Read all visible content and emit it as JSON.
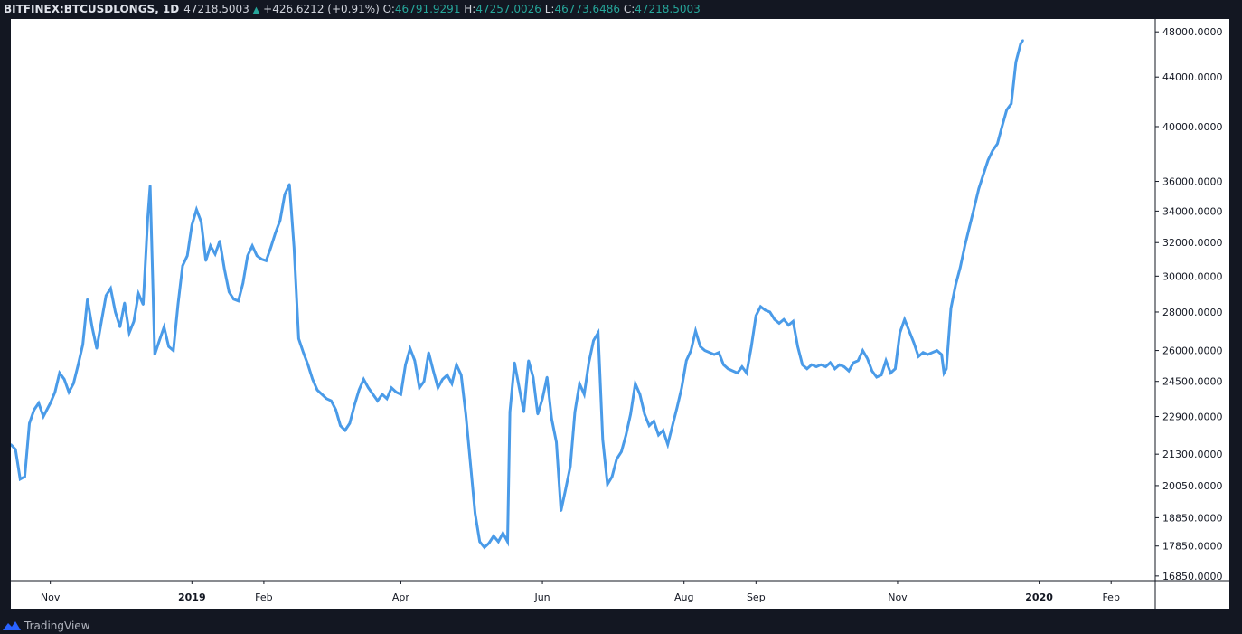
{
  "header": {
    "symbol": "BITFINEX:BTCUSDLONGS, 1D",
    "last": "47218.5003",
    "change_arrow": "▲",
    "change": "+426.6212 (+0.91%)",
    "open_label": "O:",
    "open": "46791.9291",
    "high_label": "H:",
    "high": "47257.0026",
    "low_label": "L:",
    "low": "46773.6486",
    "close_label": "C:",
    "close": "47218.5003"
  },
  "footer": {
    "brand": "TradingView"
  },
  "colors": {
    "line": "#4a9be8",
    "background": "#ffffff",
    "frame": "#131722",
    "axis_text": "#131722",
    "up": "#26a69a"
  },
  "chart_data": {
    "type": "line",
    "x_axis": {
      "type": "date",
      "range": [
        "2018-10-15",
        "2020-02-20"
      ],
      "ticks": [
        {
          "date": "2018-11-01",
          "label": "Nov",
          "bold": false
        },
        {
          "date": "2019-01-01",
          "label": "2019",
          "bold": true
        },
        {
          "date": "2019-02-01",
          "label": "Feb",
          "bold": false
        },
        {
          "date": "2019-04-01",
          "label": "Apr",
          "bold": false
        },
        {
          "date": "2019-06-01",
          "label": "Jun",
          "bold": false
        },
        {
          "date": "2019-08-01",
          "label": "Aug",
          "bold": false
        },
        {
          "date": "2019-09-01",
          "label": "Sep",
          "bold": false
        },
        {
          "date": "2019-11-01",
          "label": "Nov",
          "bold": false
        },
        {
          "date": "2020-01-01",
          "label": "2020",
          "bold": true
        },
        {
          "date": "2020-02-01",
          "label": "Feb",
          "bold": false
        }
      ]
    },
    "y_axis": {
      "scale": "log",
      "range": [
        16700,
        49200
      ],
      "ticks": [
        {
          "value": 48000,
          "label": "48000.0000"
        },
        {
          "value": 44000,
          "label": "44000.0000"
        },
        {
          "value": 40000,
          "label": "40000.0000"
        },
        {
          "value": 36000,
          "label": "36000.0000"
        },
        {
          "value": 34000,
          "label": "34000.0000"
        },
        {
          "value": 32000,
          "label": "32000.0000"
        },
        {
          "value": 30000,
          "label": "30000.0000"
        },
        {
          "value": 28000,
          "label": "28000.0000"
        },
        {
          "value": 26000,
          "label": "26000.0000"
        },
        {
          "value": 24500,
          "label": "24500.0000"
        },
        {
          "value": 22900,
          "label": "22900.0000"
        },
        {
          "value": 21300,
          "label": "21300.0000"
        },
        {
          "value": 20050,
          "label": "20050.0000"
        },
        {
          "value": 18850,
          "label": "18850.0000"
        },
        {
          "value": 17850,
          "label": "17850.0000"
        },
        {
          "value": 16850,
          "label": "16850.0000"
        }
      ]
    },
    "grid": false,
    "series": [
      {
        "values": [
          [
            "2018-10-15",
            21700
          ],
          [
            "2018-10-17",
            21500
          ],
          [
            "2018-10-19",
            20300
          ],
          [
            "2018-10-21",
            20400
          ],
          [
            "2018-10-23",
            22600
          ],
          [
            "2018-10-25",
            23200
          ],
          [
            "2018-10-27",
            23500
          ],
          [
            "2018-10-29",
            22900
          ],
          [
            "2018-11-01",
            23500
          ],
          [
            "2018-11-03",
            24000
          ],
          [
            "2018-11-05",
            24900
          ],
          [
            "2018-11-07",
            24600
          ],
          [
            "2018-11-09",
            24000
          ],
          [
            "2018-11-11",
            24400
          ],
          [
            "2018-11-13",
            25300
          ],
          [
            "2018-11-15",
            26300
          ],
          [
            "2018-11-17",
            28700
          ],
          [
            "2018-11-19",
            27200
          ],
          [
            "2018-11-21",
            26100
          ],
          [
            "2018-11-23",
            27500
          ],
          [
            "2018-11-25",
            28900
          ],
          [
            "2018-11-27",
            29300
          ],
          [
            "2018-11-29",
            28000
          ],
          [
            "2018-12-01",
            27200
          ],
          [
            "2018-12-03",
            28500
          ],
          [
            "2018-12-05",
            26900
          ],
          [
            "2018-12-07",
            27500
          ],
          [
            "2018-12-09",
            29000
          ],
          [
            "2018-12-11",
            28400
          ],
          [
            "2018-12-13",
            33600
          ],
          [
            "2018-12-14",
            35700
          ],
          [
            "2018-12-16",
            25800
          ],
          [
            "2018-12-18",
            26500
          ],
          [
            "2018-12-20",
            27200
          ],
          [
            "2018-12-22",
            26200
          ],
          [
            "2018-12-24",
            26000
          ],
          [
            "2018-12-26",
            28400
          ],
          [
            "2018-12-28",
            30600
          ],
          [
            "2018-12-30",
            31200
          ],
          [
            "2019-01-01",
            33100
          ],
          [
            "2019-01-03",
            34100
          ],
          [
            "2019-01-05",
            33300
          ],
          [
            "2019-01-07",
            30900
          ],
          [
            "2019-01-09",
            31800
          ],
          [
            "2019-01-11",
            31300
          ],
          [
            "2019-01-13",
            32100
          ],
          [
            "2019-01-15",
            30400
          ],
          [
            "2019-01-17",
            29100
          ],
          [
            "2019-01-19",
            28700
          ],
          [
            "2019-01-21",
            28600
          ],
          [
            "2019-01-23",
            29600
          ],
          [
            "2019-01-25",
            31200
          ],
          [
            "2019-01-27",
            31800
          ],
          [
            "2019-01-29",
            31200
          ],
          [
            "2019-01-31",
            31000
          ],
          [
            "2019-02-02",
            30900
          ],
          [
            "2019-02-04",
            31700
          ],
          [
            "2019-02-06",
            32600
          ],
          [
            "2019-02-08",
            33400
          ],
          [
            "2019-02-10",
            35100
          ],
          [
            "2019-02-12",
            35800
          ],
          [
            "2019-02-14",
            31700
          ],
          [
            "2019-02-16",
            26600
          ],
          [
            "2019-02-18",
            25900
          ],
          [
            "2019-02-20",
            25300
          ],
          [
            "2019-02-22",
            24600
          ],
          [
            "2019-02-24",
            24100
          ],
          [
            "2019-02-26",
            23900
          ],
          [
            "2019-02-28",
            23700
          ],
          [
            "2019-03-02",
            23600
          ],
          [
            "2019-03-04",
            23200
          ],
          [
            "2019-03-06",
            22500
          ],
          [
            "2019-03-08",
            22300
          ],
          [
            "2019-03-10",
            22600
          ],
          [
            "2019-03-12",
            23400
          ],
          [
            "2019-03-14",
            24100
          ],
          [
            "2019-03-16",
            24600
          ],
          [
            "2019-03-18",
            24200
          ],
          [
            "2019-03-20",
            23900
          ],
          [
            "2019-03-22",
            23600
          ],
          [
            "2019-03-24",
            23900
          ],
          [
            "2019-03-26",
            23700
          ],
          [
            "2019-03-28",
            24200
          ],
          [
            "2019-03-30",
            24000
          ],
          [
            "2019-04-01",
            23900
          ],
          [
            "2019-04-03",
            25300
          ],
          [
            "2019-04-05",
            26100
          ],
          [
            "2019-04-07",
            25500
          ],
          [
            "2019-04-09",
            24200
          ],
          [
            "2019-04-11",
            24500
          ],
          [
            "2019-04-13",
            25900
          ],
          [
            "2019-04-15",
            25000
          ],
          [
            "2019-04-17",
            24200
          ],
          [
            "2019-04-19",
            24600
          ],
          [
            "2019-04-21",
            24800
          ],
          [
            "2019-04-23",
            24400
          ],
          [
            "2019-04-25",
            25300
          ],
          [
            "2019-04-27",
            24800
          ],
          [
            "2019-04-29",
            23000
          ],
          [
            "2019-05-01",
            20900
          ],
          [
            "2019-05-03",
            19000
          ],
          [
            "2019-05-05",
            18000
          ],
          [
            "2019-05-07",
            17800
          ],
          [
            "2019-05-09",
            17950
          ],
          [
            "2019-05-11",
            18200
          ],
          [
            "2019-05-13",
            18000
          ],
          [
            "2019-05-15",
            18300
          ],
          [
            "2019-05-17",
            18000
          ],
          [
            "2019-05-18",
            23100
          ],
          [
            "2019-05-20",
            25400
          ],
          [
            "2019-05-22",
            24200
          ],
          [
            "2019-05-24",
            23100
          ],
          [
            "2019-05-26",
            25500
          ],
          [
            "2019-05-28",
            24700
          ],
          [
            "2019-05-30",
            23000
          ],
          [
            "2019-06-01",
            23700
          ],
          [
            "2019-06-03",
            24700
          ],
          [
            "2019-06-05",
            22800
          ],
          [
            "2019-06-07",
            21800
          ],
          [
            "2019-06-09",
            19100
          ],
          [
            "2019-06-11",
            19900
          ],
          [
            "2019-06-13",
            20800
          ],
          [
            "2019-06-15",
            23100
          ],
          [
            "2019-06-17",
            24400
          ],
          [
            "2019-06-19",
            23900
          ],
          [
            "2019-06-21",
            25400
          ],
          [
            "2019-06-23",
            26500
          ],
          [
            "2019-06-25",
            26900
          ],
          [
            "2019-06-27",
            21900
          ],
          [
            "2019-06-29",
            20100
          ],
          [
            "2019-07-01",
            20400
          ],
          [
            "2019-07-03",
            21100
          ],
          [
            "2019-07-05",
            21400
          ],
          [
            "2019-07-07",
            22100
          ],
          [
            "2019-07-09",
            23000
          ],
          [
            "2019-07-11",
            24400
          ],
          [
            "2019-07-13",
            23900
          ],
          [
            "2019-07-15",
            23000
          ],
          [
            "2019-07-17",
            22500
          ],
          [
            "2019-07-19",
            22700
          ],
          [
            "2019-07-21",
            22100
          ],
          [
            "2019-07-23",
            22300
          ],
          [
            "2019-07-25",
            21700
          ],
          [
            "2019-07-27",
            22500
          ],
          [
            "2019-07-29",
            23300
          ],
          [
            "2019-07-31",
            24200
          ],
          [
            "2019-08-02",
            25500
          ],
          [
            "2019-08-04",
            26000
          ],
          [
            "2019-08-06",
            27000
          ],
          [
            "2019-08-08",
            26200
          ],
          [
            "2019-08-10",
            26000
          ],
          [
            "2019-08-12",
            25900
          ],
          [
            "2019-08-14",
            25800
          ],
          [
            "2019-08-16",
            25900
          ],
          [
            "2019-08-18",
            25300
          ],
          [
            "2019-08-20",
            25100
          ],
          [
            "2019-08-22",
            25000
          ],
          [
            "2019-08-24",
            24900
          ],
          [
            "2019-08-26",
            25200
          ],
          [
            "2019-08-28",
            24900
          ],
          [
            "2019-08-30",
            26200
          ],
          [
            "2019-09-01",
            27800
          ],
          [
            "2019-09-03",
            28300
          ],
          [
            "2019-09-05",
            28100
          ],
          [
            "2019-09-07",
            28000
          ],
          [
            "2019-09-09",
            27600
          ],
          [
            "2019-09-11",
            27400
          ],
          [
            "2019-09-13",
            27600
          ],
          [
            "2019-09-15",
            27300
          ],
          [
            "2019-09-17",
            27500
          ],
          [
            "2019-09-19",
            26200
          ],
          [
            "2019-09-21",
            25300
          ],
          [
            "2019-09-23",
            25100
          ],
          [
            "2019-09-25",
            25300
          ],
          [
            "2019-09-27",
            25200
          ],
          [
            "2019-09-29",
            25300
          ],
          [
            "2019-10-01",
            25200
          ],
          [
            "2019-10-03",
            25400
          ],
          [
            "2019-10-05",
            25100
          ],
          [
            "2019-10-07",
            25300
          ],
          [
            "2019-10-09",
            25200
          ],
          [
            "2019-10-11",
            25000
          ],
          [
            "2019-10-13",
            25400
          ],
          [
            "2019-10-15",
            25500
          ],
          [
            "2019-10-17",
            26000
          ],
          [
            "2019-10-19",
            25600
          ],
          [
            "2019-10-21",
            25000
          ],
          [
            "2019-10-23",
            24700
          ],
          [
            "2019-10-25",
            24800
          ],
          [
            "2019-10-27",
            25500
          ],
          [
            "2019-10-29",
            24900
          ],
          [
            "2019-10-31",
            25100
          ],
          [
            "2019-11-02",
            26900
          ],
          [
            "2019-11-04",
            27600
          ],
          [
            "2019-11-06",
            27000
          ],
          [
            "2019-11-08",
            26400
          ],
          [
            "2019-11-10",
            25700
          ],
          [
            "2019-11-12",
            25900
          ],
          [
            "2019-11-14",
            25800
          ],
          [
            "2019-11-16",
            25900
          ],
          [
            "2019-11-18",
            26000
          ],
          [
            "2019-11-20",
            25800
          ],
          [
            "2019-11-21",
            24900
          ],
          [
            "2019-11-22",
            25100
          ],
          [
            "2019-11-24",
            28200
          ],
          [
            "2019-11-26",
            29500
          ],
          [
            "2019-11-28",
            30500
          ],
          [
            "2019-11-30",
            31800
          ],
          [
            "2019-12-02",
            33000
          ],
          [
            "2019-12-04",
            34200
          ],
          [
            "2019-12-06",
            35500
          ],
          [
            "2019-12-08",
            36500
          ],
          [
            "2019-12-10",
            37500
          ],
          [
            "2019-12-12",
            38200
          ],
          [
            "2019-12-14",
            38700
          ],
          [
            "2019-12-16",
            40000
          ],
          [
            "2019-12-18",
            41300
          ],
          [
            "2019-12-20",
            41800
          ],
          [
            "2019-12-22",
            45300
          ],
          [
            "2019-12-24",
            46900
          ],
          [
            "2019-12-25",
            47218.5
          ]
        ]
      }
    ]
  }
}
